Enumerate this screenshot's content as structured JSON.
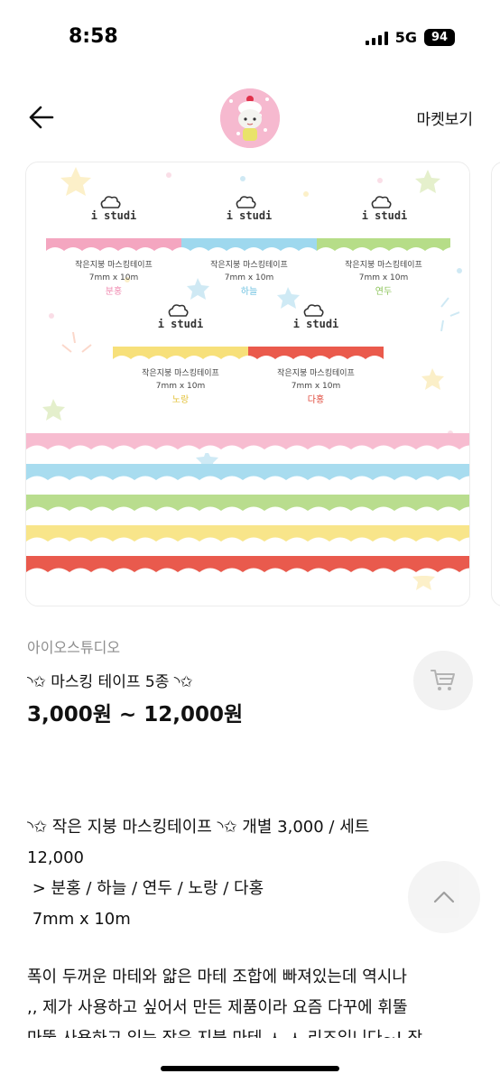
{
  "status_bar": {
    "time": "8:58",
    "network": "5G",
    "battery": "94"
  },
  "header": {
    "market_link": "마켓보기"
  },
  "image": {
    "brand": "i studi",
    "samples": [
      {
        "label": "작은지붕 마스킹테이프",
        "size": "7mm x 10m",
        "color_name": "분홍",
        "color": "#f4a6c0"
      },
      {
        "label": "작은지붕 마스킹테이프",
        "size": "7mm x 10m",
        "color_name": "하늘",
        "color": "#9ed8ee"
      },
      {
        "label": "작은지붕 마스킹테이프",
        "size": "7mm x 10m",
        "color_name": "연두",
        "color": "#b6dd88"
      },
      {
        "label": "작은지붕 마스킹테이프",
        "size": "7mm x 10m",
        "color_name": "노랑",
        "color": "#f7e07a"
      },
      {
        "label": "작은지붕 마스킹테이프",
        "size": "7mm x 10m",
        "color_name": "다홍",
        "color": "#ea5a4c"
      }
    ]
  },
  "product": {
    "seller": "아이오스튜디오",
    "title": "◝✩ 마스킹 테이프 5종 ◝✩",
    "price": "3,000원 ~ 12,000원"
  },
  "description": {
    "lines": [
      "◝✩ 작은 지붕 마스킹테이프 ◝✩ 개별 3,000 / 세트",
      "12,000",
      " > 분홍 / 하늘 / 연두 / 노랑 / 다홍",
      " 7mm x 10m"
    ],
    "body_lines": [
      "폭이 두꺼운 마테와 얇은 마테 조합에 빠져있는데 역시나",
      ",, 제가 사용하고 싶어서 만든 제품이라 요즘 다꾸에 휘뚤",
      "마뚤 사용하고 있는 작은 지붕 마테 ㅅ ㅅ 리즈입니다~! 작"
    ]
  }
}
